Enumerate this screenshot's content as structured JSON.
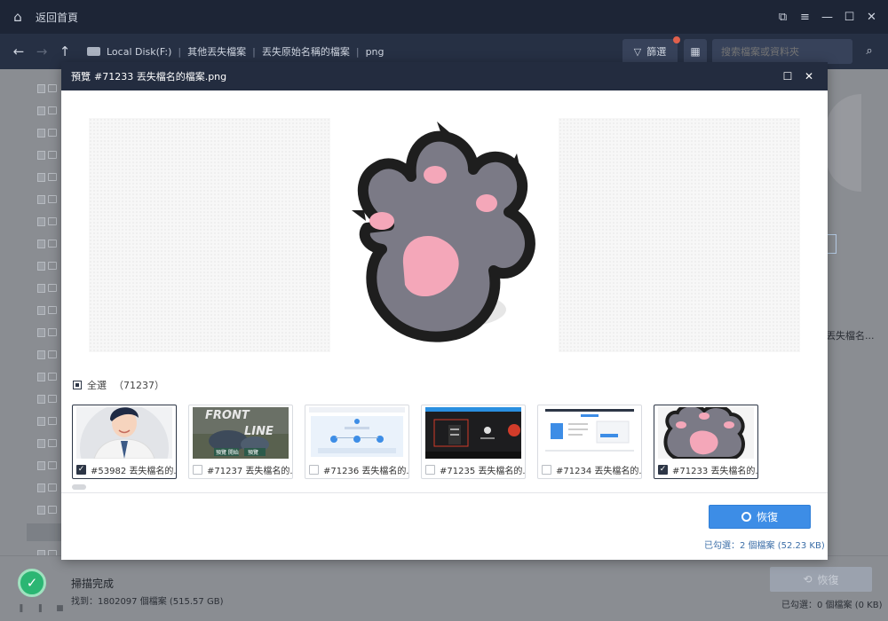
{
  "window": {
    "back_home_label": "返回首頁",
    "controls": [
      "⧉",
      "≡",
      "—",
      "☐",
      "✕"
    ]
  },
  "nav": {
    "drive_label": "Local Disk(F:)",
    "crumbs": [
      "其他丟失檔案",
      "丟失原始名稱的檔案",
      "png"
    ],
    "filter_label": "篩選",
    "search_placeholder": "搜索檔案或資料夾"
  },
  "background": {
    "right_text": "丟失檔名..."
  },
  "status": {
    "scan_title": "掃描完成",
    "found_text": "找到：1802097 個檔案 (515.57 GB)",
    "recover_label": "恢復",
    "selected_text": "已勾選：0 個檔案 (0 KB)"
  },
  "modal": {
    "title_label": "預覽",
    "title_file": "#71233 丟失檔名的檔案.png",
    "select_all_label": "全選",
    "select_all_count": "（71237）",
    "thumbnails": [
      {
        "caption": "#53982 丟失檔名的...",
        "checked": true
      },
      {
        "caption": "#71237 丟失檔名的...",
        "checked": false
      },
      {
        "caption": "#71236 丟失檔名的...",
        "checked": false
      },
      {
        "caption": "#71235 丟失檔名的...",
        "checked": false
      },
      {
        "caption": "#71234 丟失檔名的...",
        "checked": false
      },
      {
        "caption": "#71233 丟失檔名的...",
        "checked": true
      }
    ],
    "recover_label": "恢復",
    "selected_info": "已勾選：2 個檔案 (52.23 KB)"
  },
  "thumb_texts": {
    "front_line_1": "FRONT",
    "front_line_2": "LINE",
    "front_btn_1": "預覽 開始",
    "front_btn_2": "預覽"
  },
  "colors": {
    "titlebar": "#1d2536",
    "modal_header": "#232c3f",
    "accent_blue": "#3d8de6",
    "success_green": "#2bb673",
    "paw_fill": "#7b7a86",
    "paw_pad": "#f4a7b9"
  }
}
